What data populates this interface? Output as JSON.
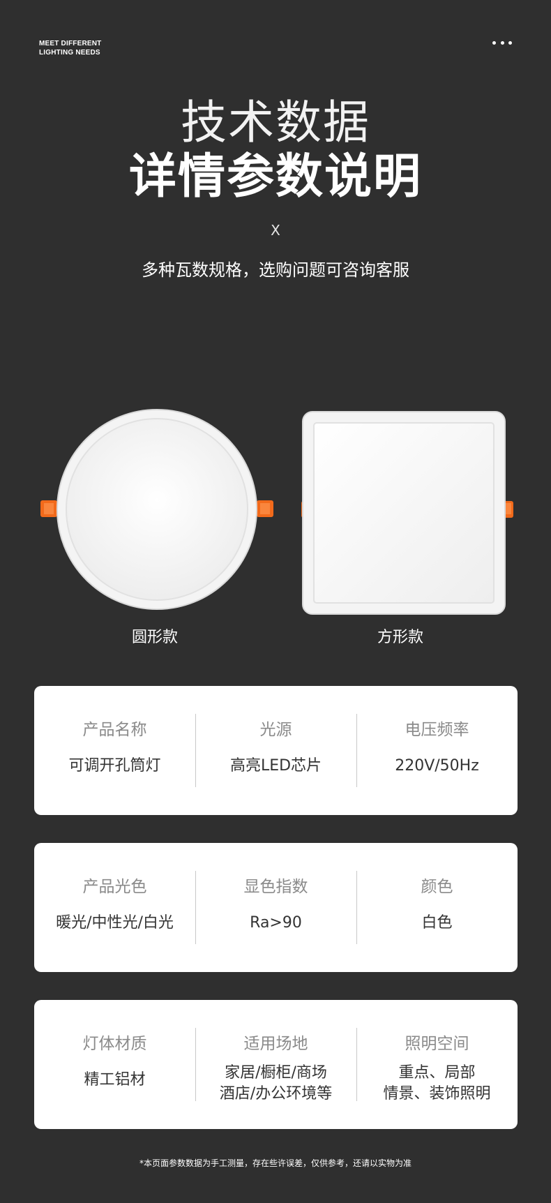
{
  "brand": {
    "line1": "MEET DIFFERENT",
    "line2": "LIGHTING NEEDS"
  },
  "menu_icon": "more-horizontal-icon",
  "header": {
    "title_light": "技术数据",
    "title_bold": "详情参数说明",
    "x_mark": "X",
    "subtitle": "多种瓦数规格，选购问题可咨询客服"
  },
  "products": [
    {
      "label": "圆形款",
      "shape": "round"
    },
    {
      "label": "方形款",
      "shape": "square"
    }
  ],
  "colors": {
    "background": "#2f2f2f",
    "card": "#ffffff",
    "spring_clip": "#f26a1b",
    "label_text": "#8a8a8a",
    "value_text": "#333333"
  },
  "specs": [
    [
      {
        "label": "产品名称",
        "value": "可调开孔筒灯"
      },
      {
        "label": "光源",
        "value": "高亮LED芯片"
      },
      {
        "label": "电压频率",
        "value": "220V/50Hz"
      }
    ],
    [
      {
        "label": "产品光色",
        "value": "暖光/中性光/白光"
      },
      {
        "label": "显色指数",
        "value": "Ra>90"
      },
      {
        "label": "颜色",
        "value": "白色"
      }
    ],
    [
      {
        "label": "灯体材质",
        "value": "精工铝材"
      },
      {
        "label": "适用场地",
        "value_line1": "家居/橱柜/商场",
        "value_line2": "酒店/办公环境等"
      },
      {
        "label": "照明空间",
        "value_line1": "重点、局部",
        "value_line2": "情景、装饰照明"
      }
    ]
  ],
  "footnote": "*本页面参数数据为手工测量，存在些许误差，仅供参考，还请以实物为准"
}
